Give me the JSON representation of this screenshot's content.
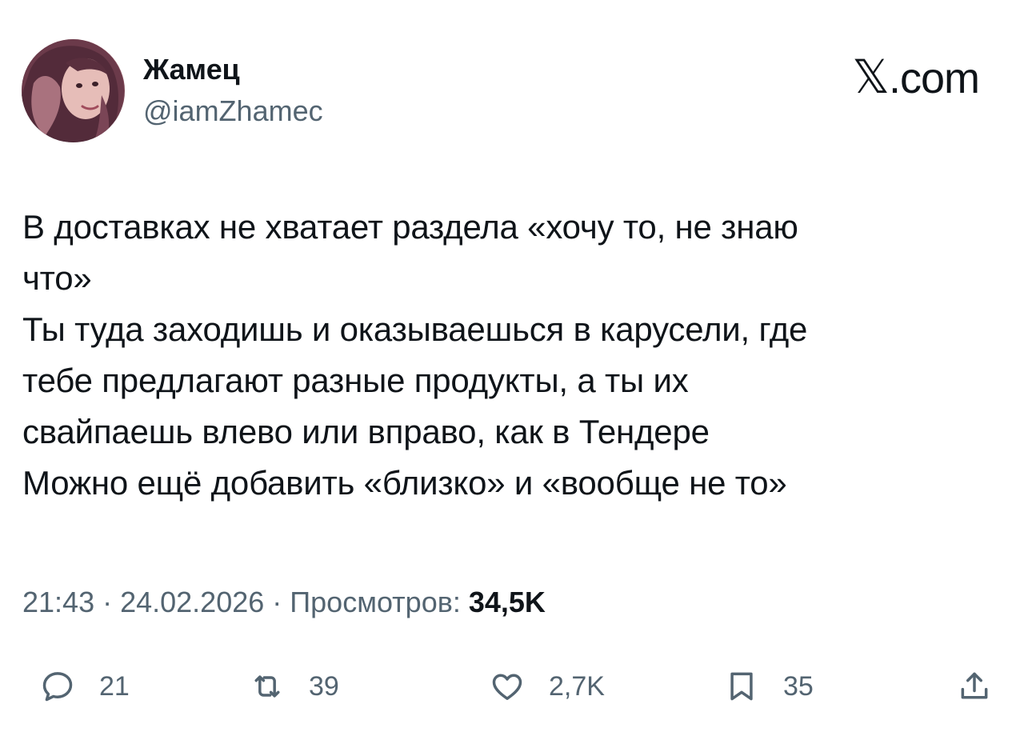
{
  "author": {
    "display_name": "Жамец",
    "handle": "@iamZhamec"
  },
  "brand": {
    "x_glyph": "𝕏",
    "suffix": ".com"
  },
  "tweet": {
    "lines": [
      "В доставках не хватает раздела «хочу то, не знаю",
      "что»",
      "Ты туда заходишь и оказываешься в карусели, где",
      "тебе предлагают разные продукты, а ты их",
      "свайпаешь влево или вправо, как в Тендере",
      "Можно ещё добавить «близко» и «вообще не то»"
    ]
  },
  "meta": {
    "time": "21:43",
    "separator": " · ",
    "date": "24.02.2026",
    "views_label": "Просмотров:",
    "views_count": "34,5K"
  },
  "actions": {
    "replies": {
      "icon": "reply-icon",
      "count": "21"
    },
    "reposts": {
      "icon": "repost-icon",
      "count": "39"
    },
    "likes": {
      "icon": "heart-icon",
      "count": "2,7K"
    },
    "bookmarks": {
      "icon": "bookmark-icon",
      "count": "35"
    },
    "share": {
      "icon": "share-icon"
    }
  },
  "colors": {
    "text": "#0f1419",
    "secondary": "#536471",
    "background": "#ffffff"
  }
}
